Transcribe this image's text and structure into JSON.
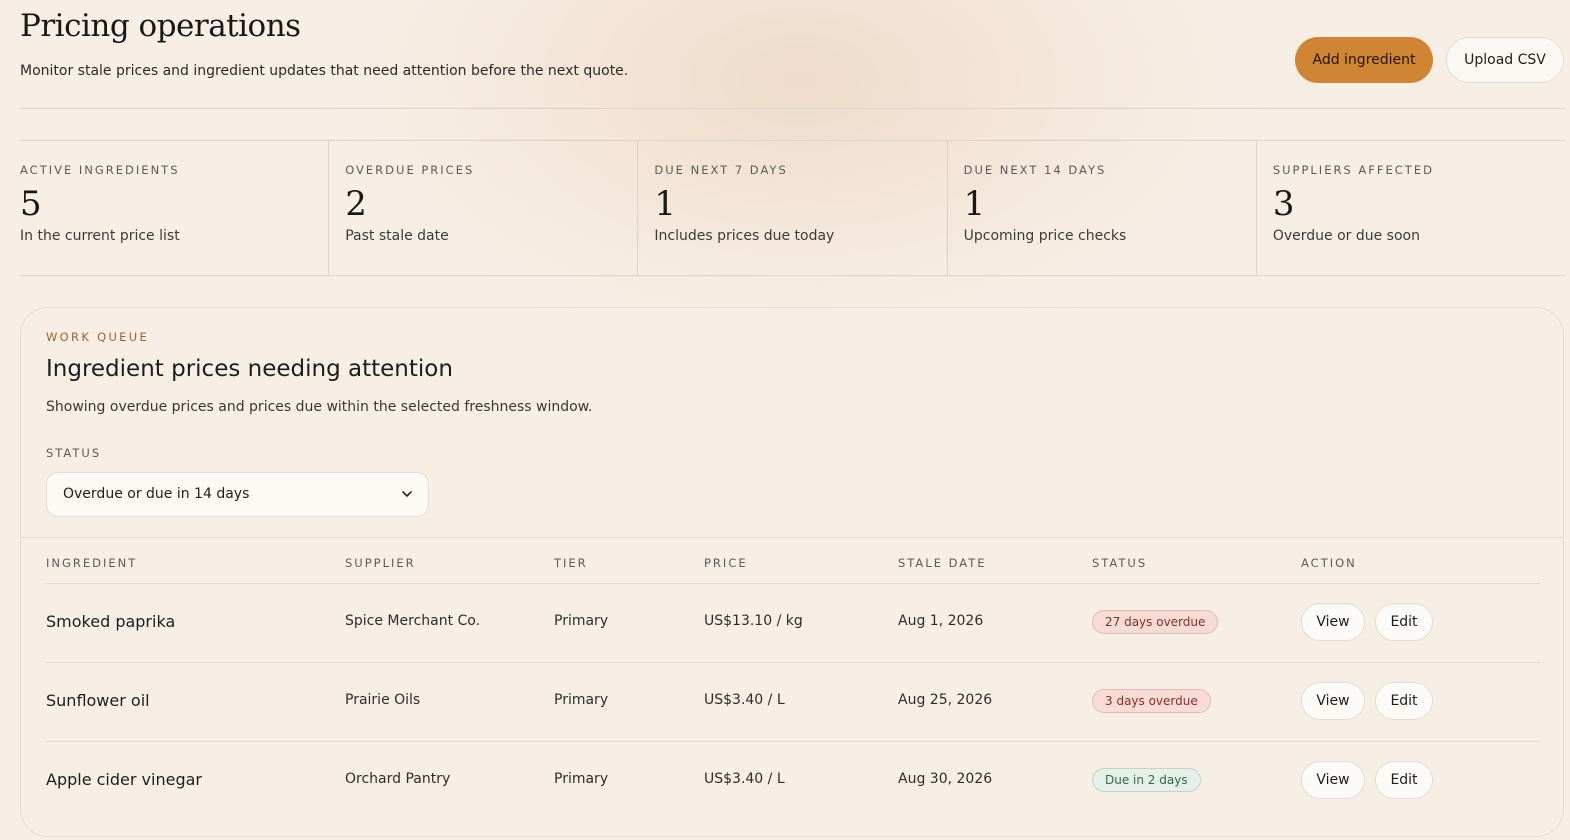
{
  "header": {
    "title": "Pricing operations",
    "subtitle": "Monitor stale prices and ingredient updates that need attention before the next quote.",
    "add_label": "Add ingredient",
    "upload_label": "Upload CSV"
  },
  "stats": [
    {
      "label": "ACTIVE INGREDIENTS",
      "value": "5",
      "note": "In the current price list"
    },
    {
      "label": "OVERDUE PRICES",
      "value": "2",
      "note": "Past stale date"
    },
    {
      "label": "DUE NEXT 7 DAYS",
      "value": "1",
      "note": "Includes prices due today"
    },
    {
      "label": "DUE NEXT 14 DAYS",
      "value": "1",
      "note": "Upcoming price checks"
    },
    {
      "label": "SUPPLIERS AFFECTED",
      "value": "3",
      "note": "Overdue or due soon"
    }
  ],
  "queue": {
    "eyebrow": "WORK QUEUE",
    "title": "Ingredient prices needing attention",
    "subtitle": "Showing overdue prices and prices due within the selected freshness window.",
    "filter_label": "STATUS",
    "filter_value": "Overdue or due in 14 days",
    "columns": [
      "INGREDIENT",
      "SUPPLIER",
      "TIER",
      "PRICE",
      "STALE DATE",
      "STATUS",
      "ACTION"
    ],
    "rows": [
      {
        "ingredient": "Smoked paprika",
        "supplier": "Spice Merchant Co.",
        "tier": "Primary",
        "price": "US$13.10 / kg",
        "stale_date": "Aug 1, 2026",
        "status": "27 days overdue",
        "status_kind": "overdue",
        "view": "View",
        "edit": "Edit"
      },
      {
        "ingredient": "Sunflower oil",
        "supplier": "Prairie Oils",
        "tier": "Primary",
        "price": "US$3.40 / L",
        "stale_date": "Aug 25, 2026",
        "status": "3 days overdue",
        "status_kind": "overdue",
        "view": "View",
        "edit": "Edit"
      },
      {
        "ingredient": "Apple cider vinegar",
        "supplier": "Orchard Pantry",
        "tier": "Primary",
        "price": "US$3.40 / L",
        "stale_date": "Aug 30, 2026",
        "status": "Due in 2 days",
        "status_kind": "due",
        "view": "View",
        "edit": "Edit"
      }
    ]
  },
  "colors": {
    "accent": "#cf8534",
    "overdue": "#8a2e22",
    "due": "#2e6b4b"
  },
  "icons": {
    "select": "chevron-down-icon"
  }
}
